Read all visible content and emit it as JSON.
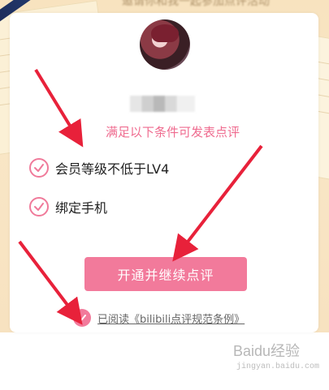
{
  "header": {
    "top_title": "邀请你和我一起参加点评活动"
  },
  "profile": {
    "username_blurred": ""
  },
  "conditions": {
    "title": "满足以下条件可发表点评",
    "items": [
      {
        "label": "会员等级不低于LV4"
      },
      {
        "label": "绑定手机"
      }
    ]
  },
  "actions": {
    "primary_label": "开通并继续点评"
  },
  "agreement": {
    "text": "已阅读《bilibili点评规范条例》"
  },
  "watermark": {
    "brand": "Baidu经验",
    "url": "jingyan.baidu.com"
  },
  "colors": {
    "accent": "#f27a9b",
    "check_border": "#f07a9a",
    "condition_title": "#ef6b8f",
    "arrow": "#e8213a",
    "background": "#f8e3bf"
  },
  "icons": {
    "condition_check": "check-circle-outline-icon",
    "agreement_check": "check-circle-filled-icon"
  }
}
